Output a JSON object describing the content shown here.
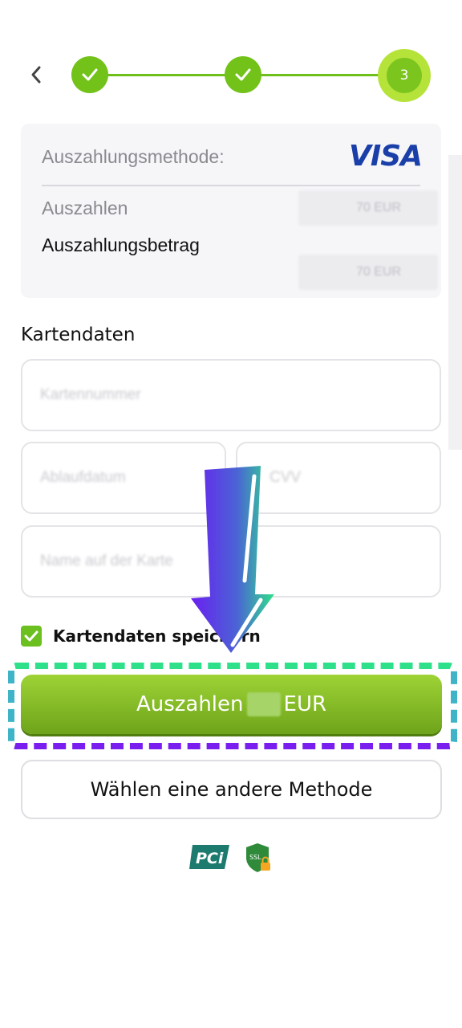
{
  "stepper": {
    "current_step": "3"
  },
  "summary": {
    "method_label": "Auszahlungsmethode:",
    "brand": "VISA",
    "payout_label": "Auszahlen",
    "payout_value": "70 EUR",
    "payout_amount_label": "Auszahlungsbetrag",
    "payout_amount_value": "70 EUR"
  },
  "card": {
    "section_title": "Kartendaten",
    "number_placeholder": "Kartennummer",
    "expiry_placeholder": "Ablaufdatum",
    "cvv_placeholder": "CVV",
    "holder_placeholder": "Name auf der Karte",
    "save_label": "Kartendaten speichern",
    "save_checked": true
  },
  "actions": {
    "payout_button_prefix": "Auszahlen",
    "payout_button_currency": "EUR",
    "alt_method_button": "Wählen eine andere Methode"
  },
  "badges": {
    "pci_icon": "pci-logo",
    "ssl_icon": "ssl-shield"
  },
  "colors": {
    "accent": "#72c21a",
    "visa": "#1a3fa8",
    "highlight_green": "#2fe08a",
    "highlight_purple": "#7a1ef0"
  }
}
